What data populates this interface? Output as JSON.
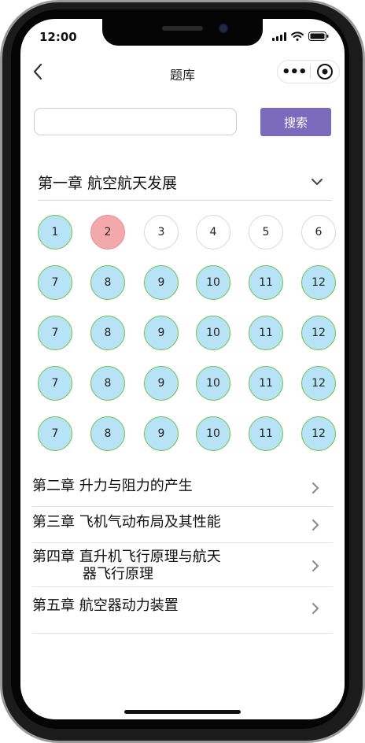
{
  "status": {
    "time": "12:00"
  },
  "nav": {
    "title": "题库",
    "more_label": "•••"
  },
  "search": {
    "placeholder": "",
    "value": "",
    "button_label": "搜索"
  },
  "chapter1": {
    "title": "第一章 航空航天发展",
    "rows": [
      [
        {
          "n": "1",
          "state": "answered"
        },
        {
          "n": "2",
          "state": "wrong"
        },
        {
          "n": "3",
          "state": "empty"
        },
        {
          "n": "4",
          "state": "empty"
        },
        {
          "n": "5",
          "state": "empty"
        },
        {
          "n": "6",
          "state": "empty"
        }
      ],
      [
        {
          "n": "7",
          "state": "answered"
        },
        {
          "n": "8",
          "state": "answered"
        },
        {
          "n": "9",
          "state": "answered"
        },
        {
          "n": "10",
          "state": "answered"
        },
        {
          "n": "11",
          "state": "answered"
        },
        {
          "n": "12",
          "state": "answered"
        }
      ],
      [
        {
          "n": "7",
          "state": "answered"
        },
        {
          "n": "8",
          "state": "answered"
        },
        {
          "n": "9",
          "state": "answered"
        },
        {
          "n": "10",
          "state": "answered"
        },
        {
          "n": "11",
          "state": "answered"
        },
        {
          "n": "12",
          "state": "answered"
        }
      ],
      [
        {
          "n": "7",
          "state": "answered"
        },
        {
          "n": "8",
          "state": "answered"
        },
        {
          "n": "9",
          "state": "answered"
        },
        {
          "n": "10",
          "state": "answered"
        },
        {
          "n": "11",
          "state": "answered"
        },
        {
          "n": "12",
          "state": "answered"
        }
      ],
      [
        {
          "n": "7",
          "state": "answered"
        },
        {
          "n": "8",
          "state": "answered"
        },
        {
          "n": "9",
          "state": "answered"
        },
        {
          "n": "10",
          "state": "answered"
        },
        {
          "n": "11",
          "state": "answered"
        },
        {
          "n": "12",
          "state": "answered"
        }
      ]
    ]
  },
  "chapters": [
    {
      "line1": "第二章 升力与阻力的产生",
      "line2": ""
    },
    {
      "line1": "第三章 飞机气动布局及其性能",
      "line2": ""
    },
    {
      "line1": "第四章 直升机飞行原理与航天",
      "line2": "器飞行原理"
    },
    {
      "line1": "第五章 航空器动力装置",
      "line2": ""
    }
  ],
  "colors": {
    "accent": "#7b6bbc",
    "answered_fill": "#b8e3f7",
    "answered_border": "#6cc34a",
    "wrong_fill": "#f3a9ab",
    "empty_border": "#d8d8d8"
  },
  "icons": {
    "back": "chevron-left-icon",
    "expand": "chevron-down-icon",
    "row": "chevron-right-icon",
    "target": "target-icon"
  }
}
